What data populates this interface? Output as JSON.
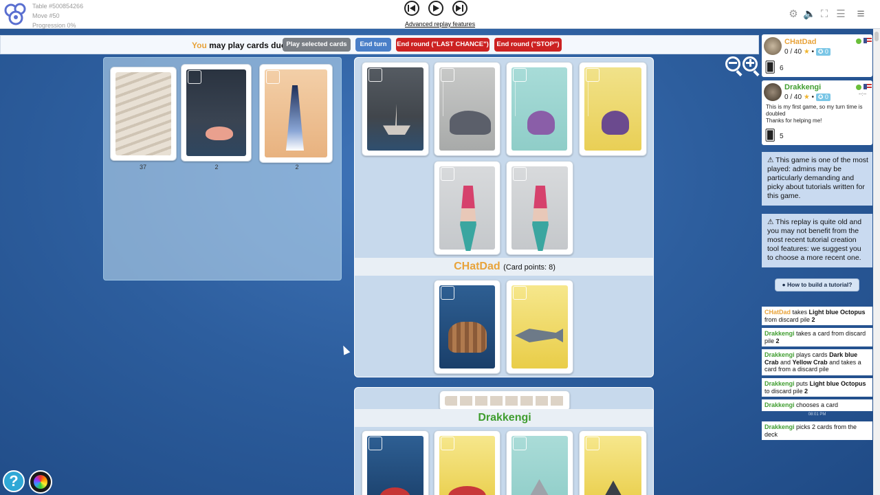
{
  "table_info": {
    "table": "Table #500854266",
    "move": "Move #50",
    "progression": "Progression 0%"
  },
  "replay": {
    "advanced_link": "Advanced replay features"
  },
  "action_bar": {
    "you": "You",
    "prompt": " may play cards duo",
    "play_selected": "Play selected cards",
    "end_turn": "End turn",
    "last_chance": "End round (\"LAST CHANCE\")",
    "stop": "End round (\"STOP\")"
  },
  "colors": {
    "orange": "#e8a33a",
    "green": "#3f9d2f",
    "red_button": "#cc2222",
    "blue_button": "#4a7fc8",
    "gray_button": "#7a7f85"
  },
  "deck": {
    "deck_count": "37",
    "pile1_count": "2",
    "pile2_count": "2"
  },
  "board": {
    "player1": "CHatDad",
    "player1_points": "(Card points: 8)",
    "player2": "Drakkengi"
  },
  "players": [
    {
      "name": "CHatDad",
      "score": "0 / 40",
      "badge": "0",
      "cards": "6"
    },
    {
      "name": "Drakkengi",
      "score": "0 / 40",
      "badge": "0",
      "status": "--:--",
      "cards": "5",
      "bio_line1": "This is my first game, so my turn time is doubled",
      "bio_line2": "Thanks for helping me!"
    }
  ],
  "notices": {
    "n1": "This game is one of the most played: admins may be particularly demanding and picky about tutorials written for this game.",
    "n2": "This replay is quite old and you may not benefit from the most recent tutorial creation tool features: we suggest you to choose a more recent one.",
    "tutorial": "How to build a tutorial?"
  },
  "log": [
    {
      "who": "CHatDad",
      "text1": " takes ",
      "card": "Light blue Octopus",
      "text2": " from discard pile ",
      "n": "2"
    },
    {
      "who": "Drakkengi",
      "text1": " takes a card from discard pile ",
      "n": "2"
    },
    {
      "who": "Drakkengi",
      "text1": " plays cards ",
      "c1": "Dark blue Crab",
      "and": " and ",
      "c2": "Yellow Crab",
      "text2": " and takes a card from a discard pile"
    },
    {
      "who": "Drakkengi",
      "text1": " puts ",
      "card": "Light blue Octopus",
      "text2": " to discard pile ",
      "n": "2"
    },
    {
      "who": "Drakkengi",
      "text1": " chooses a card"
    },
    {
      "time": "08:01 PM"
    },
    {
      "who": "Drakkengi",
      "text1": " picks 2 cards from the deck"
    }
  ]
}
